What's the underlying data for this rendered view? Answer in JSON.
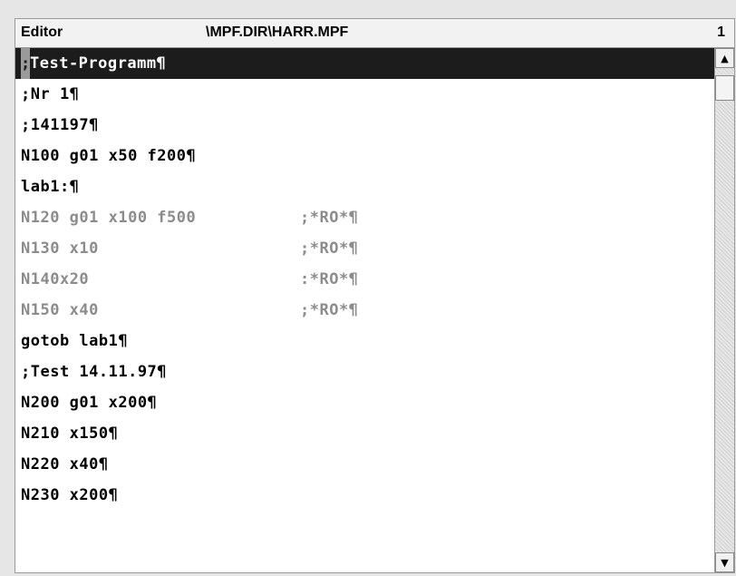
{
  "titlebar": {
    "app": "Editor",
    "path": "\\MPF.DIR\\HARR.MPF",
    "number": "1"
  },
  "selected_line": {
    "cursor_char": ";",
    "text": "Test-Programm¶"
  },
  "lines": [
    {
      "text": ";Nr 1¶",
      "comment": ""
    },
    {
      "text": ";141197¶",
      "comment": ""
    },
    {
      "text": "N100 g01 x50 f200¶",
      "comment": ""
    },
    {
      "text": "lab1:¶",
      "comment": ""
    },
    {
      "text": "N120 g01 x100 f500",
      "comment": ";*RO*¶"
    },
    {
      "text": "N130 x10",
      "comment": ";*RO*¶"
    },
    {
      "text": "N140x20",
      "comment": ":*RO*¶"
    },
    {
      "text": "N150 x40",
      "comment": ";*RO*¶"
    },
    {
      "text": "gotob lab1¶",
      "comment": ""
    },
    {
      "text": ";Test 14.11.97¶",
      "comment": ""
    },
    {
      "text": "N200 g01 x200¶",
      "comment": ""
    },
    {
      "text": "N210 x150¶",
      "comment": ""
    },
    {
      "text": "N220 x40¶",
      "comment": ""
    },
    {
      "text": "N230 x200¶",
      "comment": ""
    }
  ],
  "scrollbar": {
    "up_icon": "arrow-up-icon",
    "down_icon": "arrow-down-icon"
  },
  "colors": {
    "selection_bg": "#1c1c1c",
    "readonly_text": "#8c8c8c"
  }
}
